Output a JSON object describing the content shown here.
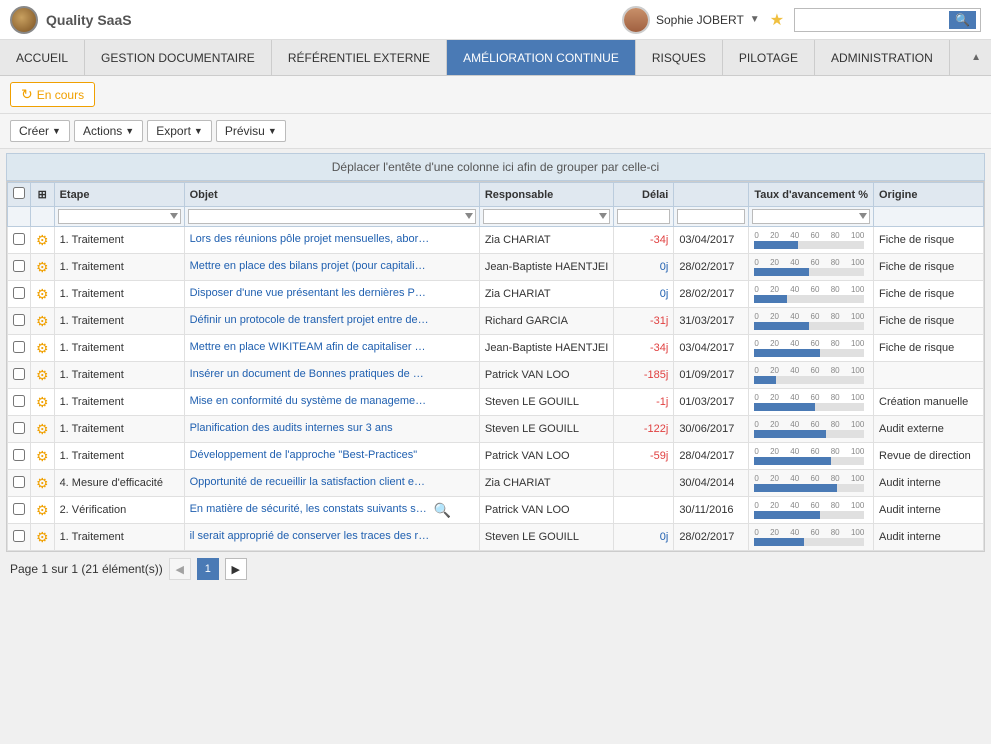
{
  "app": {
    "name": "Quality SaaS"
  },
  "header": {
    "user": "Sophie JOBERT",
    "search_placeholder": ""
  },
  "nav": {
    "items": [
      {
        "id": "accueil",
        "label": "ACCUEIL",
        "active": false
      },
      {
        "id": "gestion-doc",
        "label": "GESTION DOCUMENTAIRE",
        "active": false
      },
      {
        "id": "referentiel",
        "label": "RÉFÉRENTIEL EXTERNE",
        "active": false
      },
      {
        "id": "amelioration",
        "label": "AMÉLIORATION CONTINUE",
        "active": true
      },
      {
        "id": "risques",
        "label": "RISQUES",
        "active": false
      },
      {
        "id": "pilotage",
        "label": "PILOTAGE",
        "active": false
      },
      {
        "id": "administration",
        "label": "ADMINISTRATION",
        "active": false
      }
    ]
  },
  "tab": {
    "label": "En cours"
  },
  "toolbar": {
    "creer_label": "Créer",
    "actions_label": "Actions",
    "export_label": "Export",
    "previsu_label": "Prévisu"
  },
  "group_header": "Déplacer l'entête d'une colonne ici afin de grouper par celle-ci",
  "table": {
    "columns": [
      {
        "id": "check",
        "label": ""
      },
      {
        "id": "expand",
        "label": "+"
      },
      {
        "id": "etape",
        "label": "Etape"
      },
      {
        "id": "objet",
        "label": "Objet"
      },
      {
        "id": "responsable",
        "label": "Responsable"
      },
      {
        "id": "delai",
        "label": "Délai"
      },
      {
        "id": "date",
        "label": ""
      },
      {
        "id": "taux",
        "label": "Taux d'avancement %"
      },
      {
        "id": "origine",
        "label": "Origine"
      }
    ],
    "rows": [
      {
        "etape": "1. Traitement",
        "objet": "Lors des réunions pôle projet mensuelles, aborder les c",
        "responsable": "Zia CHARIAT",
        "delai": "-34j",
        "delai_type": "neg",
        "date": "03/04/2017",
        "taux": 40,
        "origine": "Fiche de risque",
        "has_search": false
      },
      {
        "etape": "1. Traitement",
        "objet": "Mettre en place des bilans projet (pour capitaliser sur le",
        "responsable": "Jean-Baptiste HAENTJEI",
        "delai": "0j",
        "delai_type": "zero",
        "date": "28/02/2017",
        "taux": 50,
        "origine": "Fiche de risque",
        "has_search": false
      },
      {
        "etape": "1. Traitement",
        "objet": "Disposer d'une vue présentant les dernières PCM publi",
        "responsable": "Zia CHARIAT",
        "delai": "0j",
        "delai_type": "zero",
        "date": "28/02/2017",
        "taux": 30,
        "origine": "Fiche de risque",
        "has_search": false
      },
      {
        "etape": "1. Traitement",
        "objet": "Définir un protocole de transfert projet entre deux DPs",
        "responsable": "Richard GARCIA",
        "delai": "-31j",
        "delai_type": "neg",
        "date": "31/03/2017",
        "taux": 50,
        "origine": "Fiche de risque",
        "has_search": false
      },
      {
        "etape": "1. Traitement",
        "objet": "Mettre en place WIKITEAM afin de capitaliser sur les c",
        "responsable": "Jean-Baptiste HAENTJEI",
        "delai": "-34j",
        "delai_type": "neg",
        "date": "03/04/2017",
        "taux": 60,
        "origine": "Fiche de risque",
        "has_search": false
      },
      {
        "etape": "1. Traitement",
        "objet": "Insérer un document de Bonnes pratiques de développ",
        "responsable": "Patrick VAN LOO",
        "delai": "-185j",
        "delai_type": "neg",
        "date": "01/09/2017",
        "taux": 20,
        "origine": "",
        "has_search": false
      },
      {
        "etape": "1. Traitement",
        "objet": "Mise en conformité du système de management aux n",
        "responsable": "Steven LE GOUILL",
        "delai": "-1j",
        "delai_type": "neg",
        "date": "01/03/2017",
        "taux": 55,
        "origine": "Création manuelle",
        "has_search": false
      },
      {
        "etape": "1. Traitement",
        "objet": "Planification des audits internes sur 3 ans",
        "responsable": "Steven LE GOUILL",
        "delai": "-122j",
        "delai_type": "neg",
        "date": "30/06/2017",
        "taux": 65,
        "origine": "Audit externe",
        "has_search": false
      },
      {
        "etape": "1. Traitement",
        "objet": "Développement de l'approche \"Best-Practices\"",
        "responsable": "Patrick VAN LOO",
        "delai": "-59j",
        "delai_type": "neg",
        "date": "28/04/2017",
        "taux": 70,
        "origine": "Revue de direction",
        "has_search": false
      },
      {
        "etape": "4. Mesure d'efficacité",
        "objet": "Opportunité de recueillir la satisfaction client en fin de",
        "responsable": "Zia CHARIAT",
        "delai": "",
        "delai_type": "neg",
        "date": "30/04/2014",
        "taux": 75,
        "origine": "Audit interne",
        "has_search": false
      },
      {
        "etape": "2. Vérification",
        "objet": "En matière de sécurité, les constats suivants sont form",
        "responsable": "Patrick VAN LOO",
        "delai": "",
        "delai_type": "neg",
        "date": "30/11/2016",
        "taux": 60,
        "origine": "Audit interne",
        "has_search": true
      },
      {
        "etape": "1. Traitement",
        "objet": "il serait approprié de conserver les traces des restaurat",
        "responsable": "Steven LE GOUILL",
        "delai": "0j",
        "delai_type": "zero",
        "date": "28/02/2017",
        "taux": 45,
        "origine": "Audit interne",
        "has_search": false
      }
    ]
  },
  "pagination": {
    "label": "Page 1 sur 1 (21 élément(s))",
    "current_page": "1",
    "has_prev": false,
    "has_next": false
  }
}
